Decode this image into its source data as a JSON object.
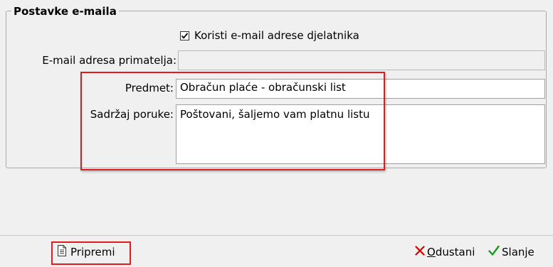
{
  "group": {
    "title": "Postavke e-maila"
  },
  "use_employee_email": {
    "label": "Koristi e-mail adrese djelatnika",
    "checked": true
  },
  "recipient": {
    "label": "E-mail adresa primatelja:",
    "value": ""
  },
  "subject": {
    "label": "Predmet:",
    "value": "Obračun plaće - obračunski list"
  },
  "body": {
    "label": "Sadržaj poruke:",
    "value": "Poštovani, šaljemo vam platnu listu"
  },
  "footer": {
    "prepare_label": "Pripremi",
    "cancel_label_first": "O",
    "cancel_label_rest": "dustani",
    "send_label": "Slanje"
  },
  "colors": {
    "highlight": "#e21c1c",
    "cancel": "#d40000",
    "send": "#1a9b1a"
  }
}
